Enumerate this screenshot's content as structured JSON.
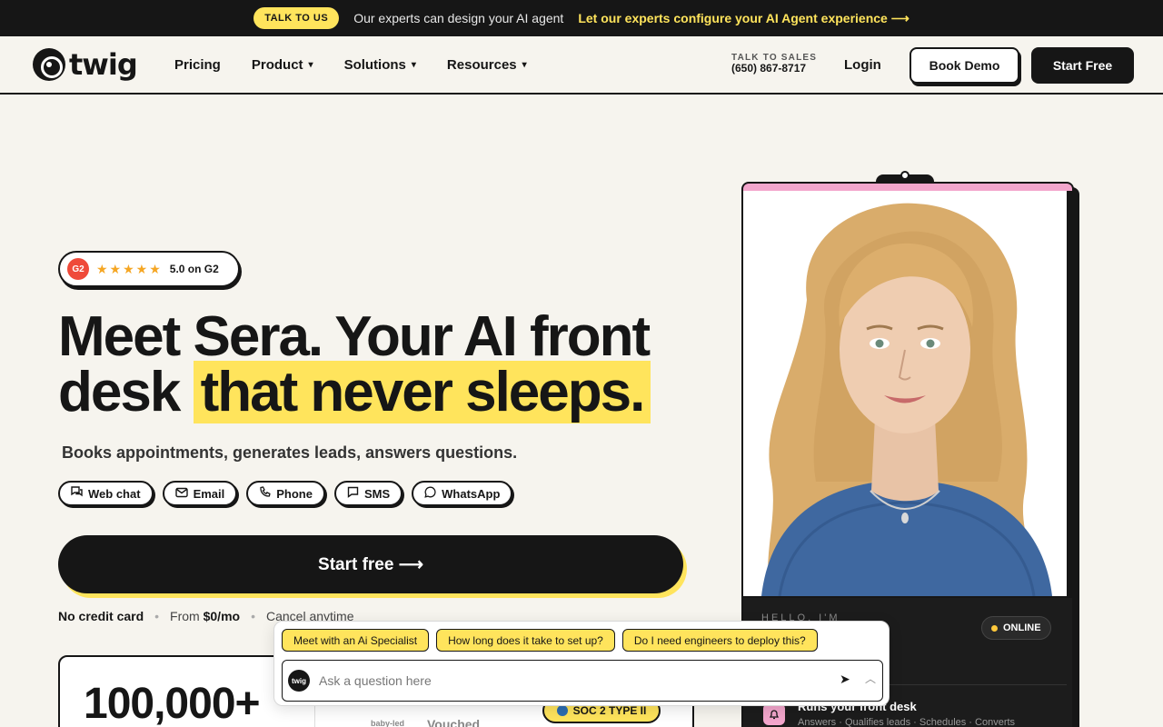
{
  "announcement": {
    "pill": "TALK TO US",
    "text": "Our experts can design your AI agent",
    "link": "Let our experts configure your AI Agent experience ⟶"
  },
  "nav": {
    "logo": "twig",
    "links": [
      "Pricing",
      "Product",
      "Solutions",
      "Resources"
    ],
    "sales_label": "TALK TO SALES",
    "sales_phone": "(650) 867-8717",
    "login": "Login",
    "book_demo": "Book Demo",
    "start_free": "Start Free"
  },
  "hero": {
    "g2_logo": "G2",
    "stars": "★★★★★",
    "rating": 5.0,
    "g2_score": "5.0 on G2",
    "title_plain": "Meet Sera. Your AI front desk",
    "title_highlight": "that never sleeps.",
    "subtitle": "Books appointments, generates leads, answers questions.",
    "channels": [
      {
        "label": "Web chat",
        "icon": "web-chat-icon"
      },
      {
        "label": "Email",
        "icon": "email-icon"
      },
      {
        "label": "Phone",
        "icon": "phone-icon"
      },
      {
        "label": "SMS",
        "icon": "sms-icon"
      },
      {
        "label": "WhatsApp",
        "icon": "whatsapp-icon"
      }
    ],
    "cta": "Start free ⟶",
    "sub_cta": {
      "no_card": "No credit card",
      "from": "From",
      "price": "$0/mo",
      "cancel": "Cancel anytime"
    }
  },
  "stats": {
    "number": "100,000+",
    "brand1": "baby-led",
    "brand2": "Vouched",
    "soc": "SOC 2 TYPE II"
  },
  "avatar": {
    "hello": "HELLO, I'M",
    "status": "ONLINE",
    "feature_title": "Runs your front desk",
    "feature_sub": "Answers · Qualifies leads · Schedules · Converts"
  },
  "chat": {
    "suggestions": [
      "Meet with an Ai Specialist",
      "How long does it take to set up?",
      "Do I need engineers to deploy this?"
    ],
    "logo": "twig",
    "placeholder": "Ask a question here"
  },
  "colors": {
    "accent_yellow": "#ffe45c",
    "dark": "#161616",
    "pink": "#f3a6cc",
    "background": "#f6f4ee"
  }
}
